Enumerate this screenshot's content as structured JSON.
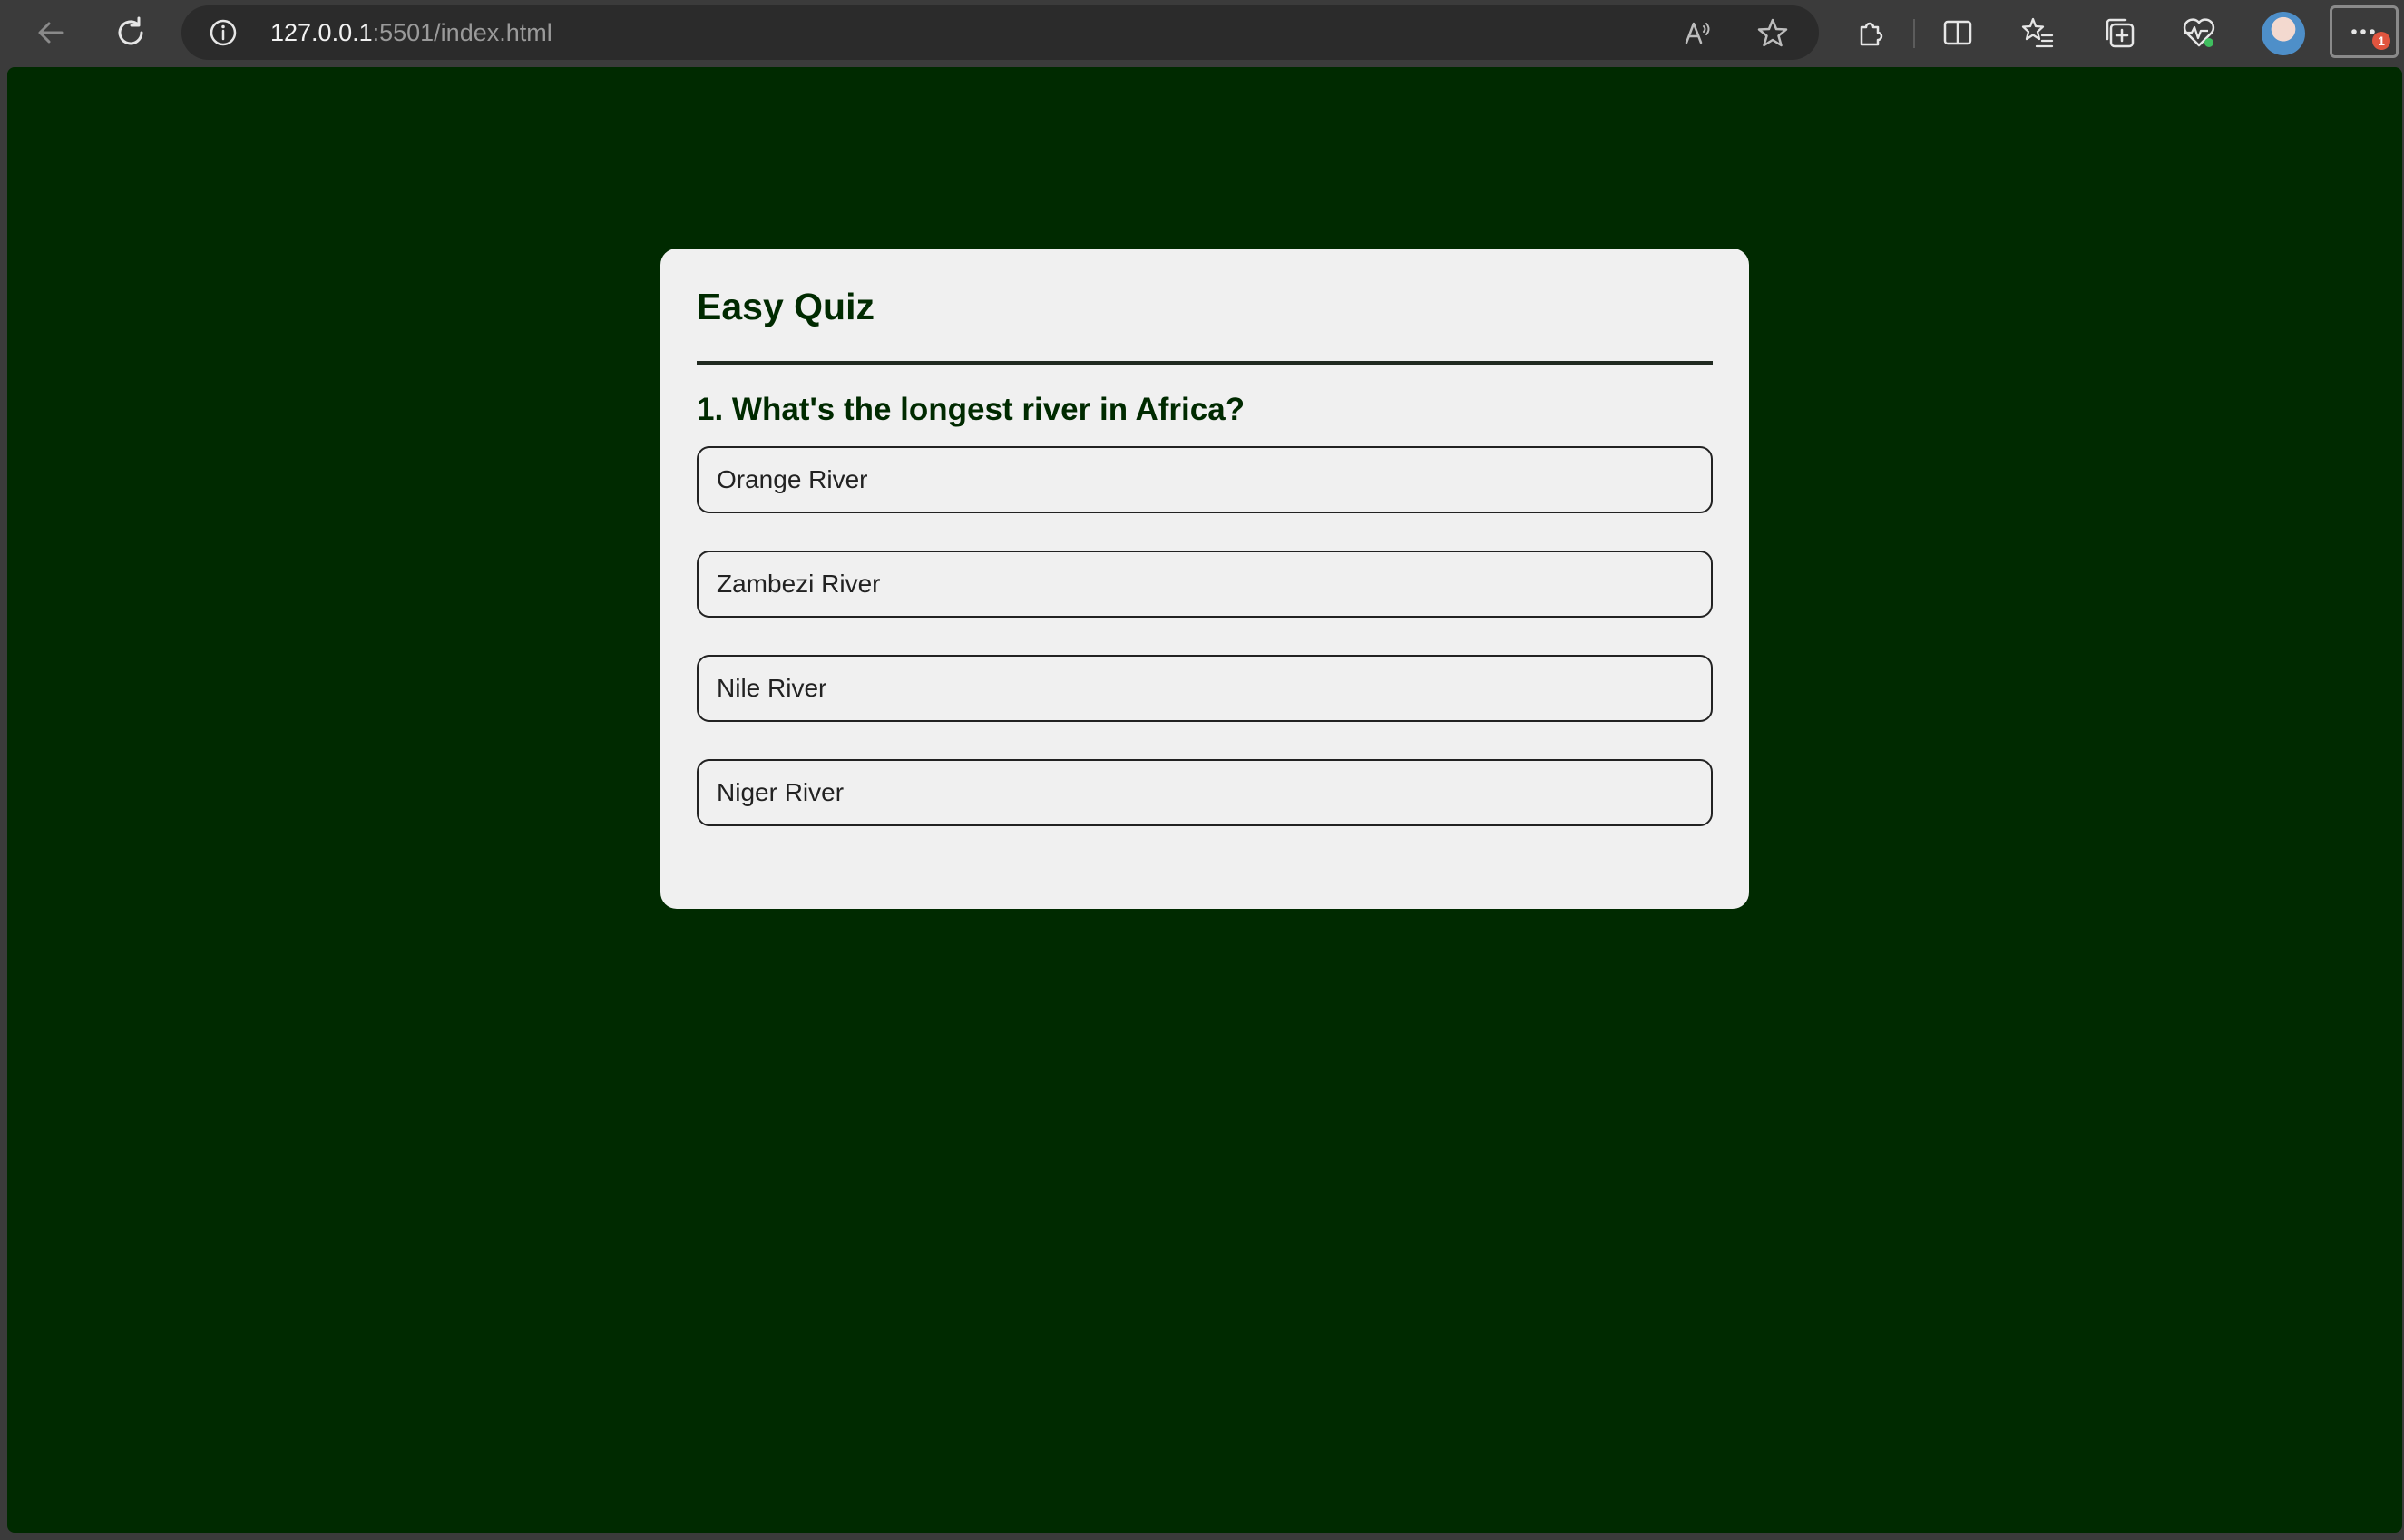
{
  "browser": {
    "url_host": "127.0.0.1",
    "url_rest": ":5501/index.html",
    "more_badge": "1",
    "toolbar_icons": [
      "back-icon",
      "refresh-icon",
      "site-info-icon",
      "read-aloud-icon",
      "favorite-star-icon",
      "extensions-icon",
      "split-screen-icon",
      "favorites-icon",
      "collections-icon",
      "browser-essentials-icon",
      "profile-avatar",
      "more-options-icon"
    ]
  },
  "quiz": {
    "title": "Easy Quiz",
    "question": "1. What's the longest river in Africa?",
    "answers": [
      "Orange River",
      "Zambezi River",
      "Nile River",
      "Niger River"
    ]
  },
  "colors": {
    "page_background": "#002a00",
    "card_background": "#f0f0f0",
    "heading_text": "#002a00",
    "browser_chrome": "#3b3b3b"
  }
}
